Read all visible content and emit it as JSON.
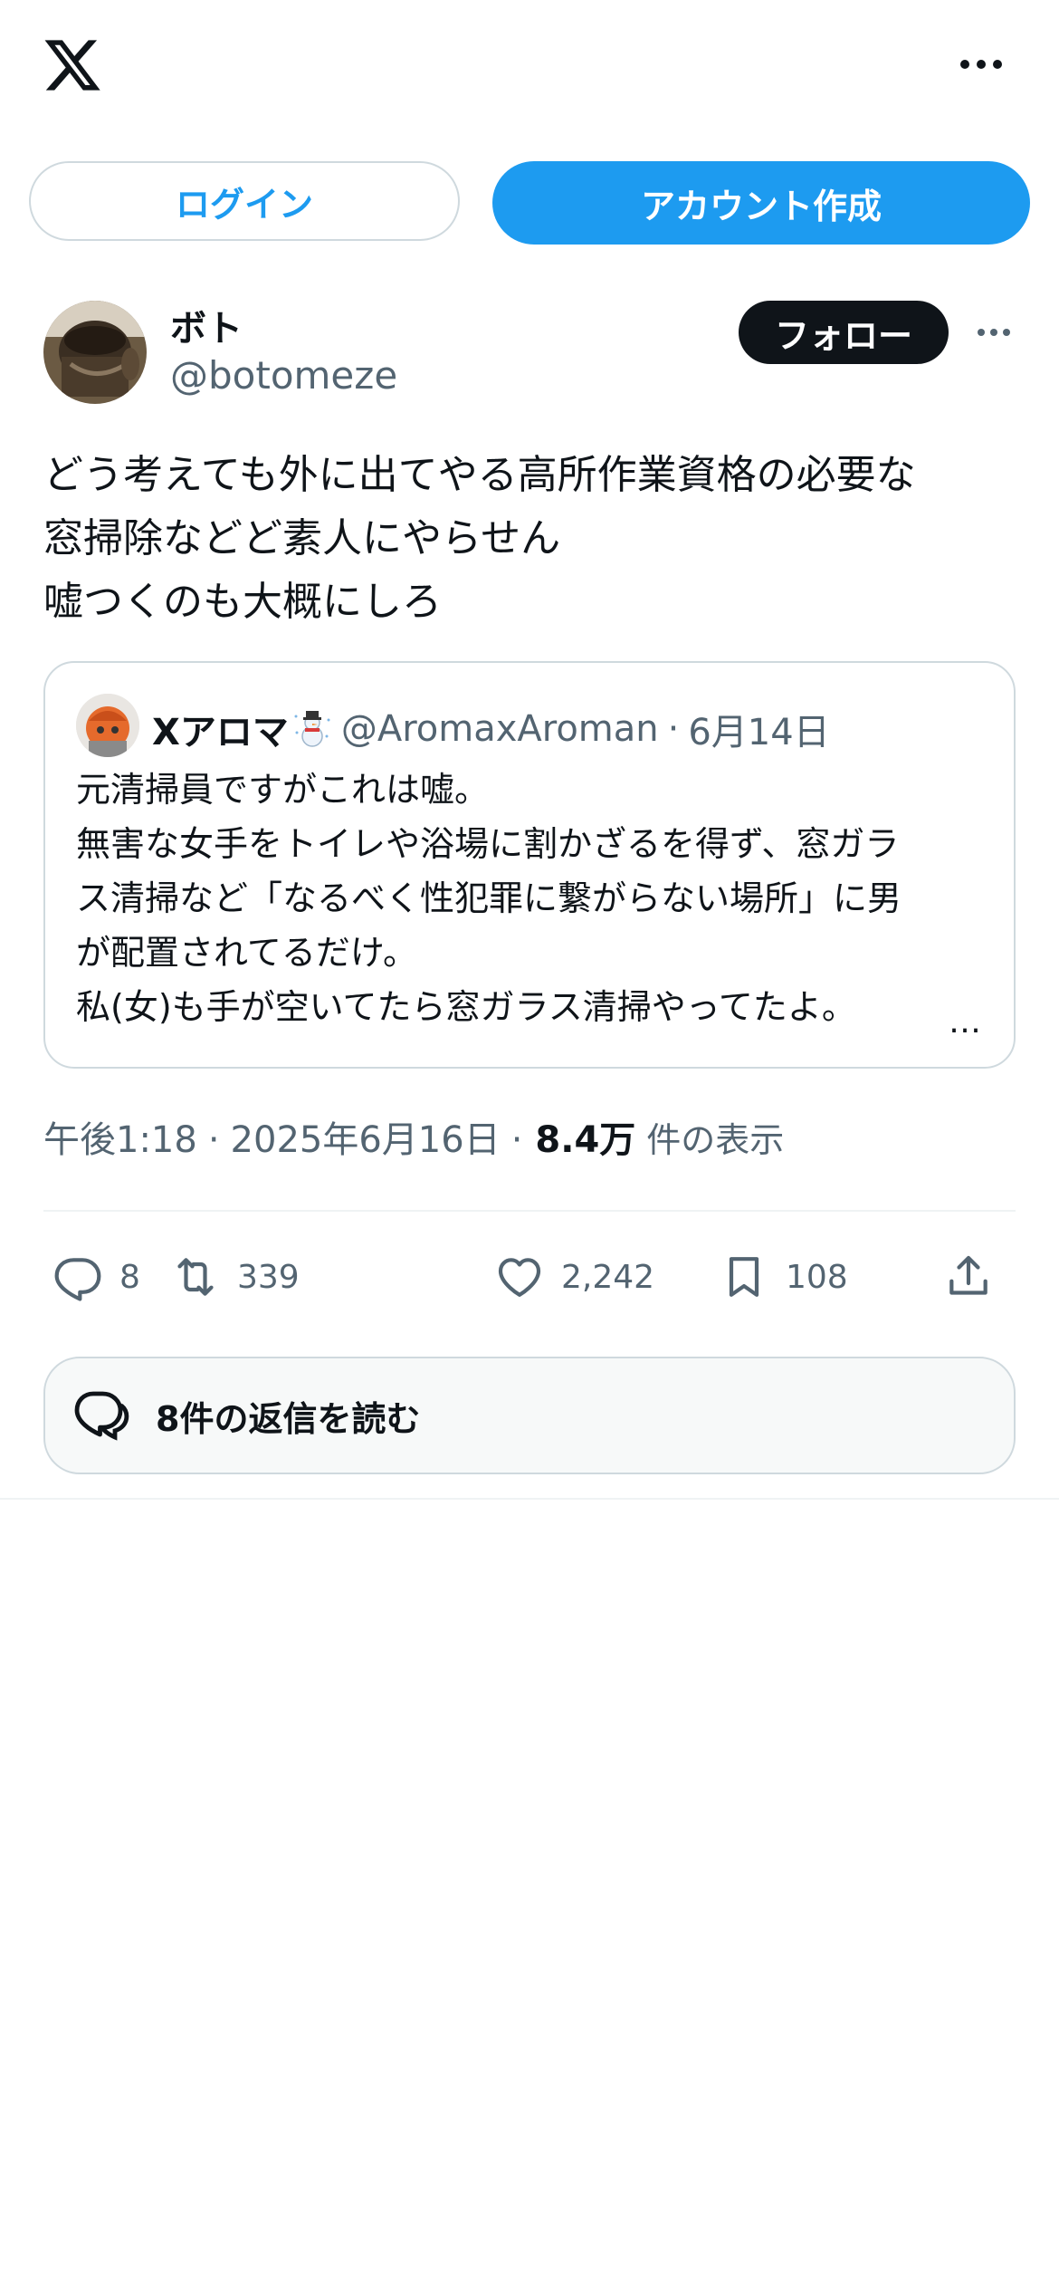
{
  "header": {
    "logo": "X",
    "more_icon": "more-horizontal-icon"
  },
  "auth": {
    "login_label": "ログイン",
    "signup_label": "アカウント作成"
  },
  "tweet": {
    "author_name": "ボト",
    "author_handle": "@botomeze",
    "follow_label": "フォロー",
    "text_lines": [
      "どう考えても外に出てやる高所作業資格の必要な",
      "窓掃除などど素人にやらせん",
      "嘘つくのも大概にしろ"
    ],
    "time": "午後1:18",
    "date": "2025年6月16日",
    "views": "8.4万",
    "views_label": "件の表示"
  },
  "quote": {
    "name": "Xアロマ",
    "handle": "@AromaxAroman",
    "separator": "·",
    "date": "6月14日",
    "lines": [
      "元清掃員ですがこれは嘘。",
      "無害な女手をトイレや浴場に割かざるを得ず、窓ガラ",
      "ス清掃など「なるべく性犯罪に繋がらない場所」に男",
      "が配置されてるだけ。",
      "私(女)も手が空いてたら窓ガラス清掃やってたよ。"
    ],
    "more": "…"
  },
  "actions": {
    "replies": "8",
    "reposts": "339",
    "likes": "2,242",
    "bookmarks": "108"
  },
  "read_replies": {
    "label": "8件の返信を読む"
  },
  "colors": {
    "accent": "#1d9bf0",
    "text": "#0f1419",
    "secondary": "#536471",
    "border": "#cfd9de"
  }
}
